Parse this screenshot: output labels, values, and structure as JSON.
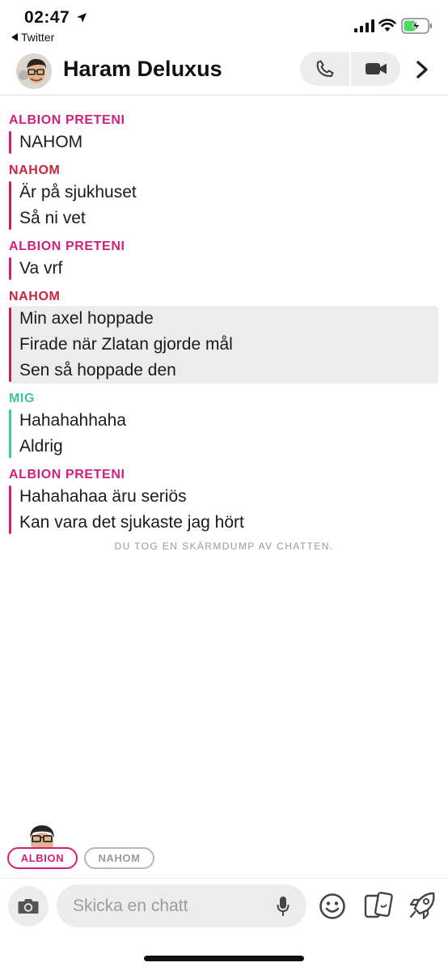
{
  "status_bar": {
    "time": "02:47",
    "back_app": "Twitter"
  },
  "header": {
    "title": "Haram Deluxus"
  },
  "colors": {
    "albion": "#d21f7c",
    "nahom": "#c8243f",
    "me": "#3ec49f"
  },
  "messages": [
    {
      "sender": "ALBION PRETENI",
      "color_key": "albion",
      "saved": false,
      "lines": [
        "NAHOM"
      ]
    },
    {
      "sender": "NAHOM",
      "color_key": "nahom",
      "saved": false,
      "lines": [
        "Är på sjukhuset",
        "Så ni vet"
      ]
    },
    {
      "sender": "ALBION PRETENI",
      "color_key": "albion",
      "saved": false,
      "lines": [
        "Va vrf"
      ]
    },
    {
      "sender": "NAHOM",
      "color_key": "nahom",
      "saved": true,
      "lines": [
        "Min axel hoppade",
        "Firade när Zlatan gjorde mål",
        "Sen så hoppade den"
      ]
    },
    {
      "sender": "MIG",
      "color_key": "me",
      "saved": false,
      "lines": [
        "Hahahahhaha",
        "Aldrig"
      ]
    },
    {
      "sender": "ALBION PRETENI",
      "color_key": "albion",
      "saved": false,
      "lines": [
        "Hahahahaa äru seriös",
        "Kan vara det sjukaste jag hört"
      ]
    }
  ],
  "screenshot_notice": "DU TOG EN SKÄRMDUMP AV CHATTEN.",
  "chips": {
    "albion": "ALBION",
    "nahom": "NAHOM"
  },
  "composer": {
    "placeholder": "Skicka en chatt"
  }
}
